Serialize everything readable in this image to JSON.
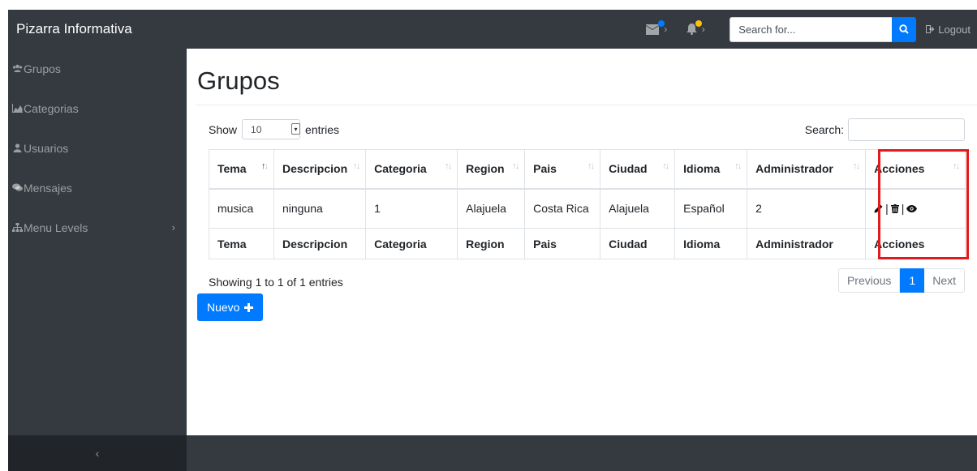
{
  "header": {
    "brand": "Pizarra Informativa",
    "search_placeholder": "Search for...",
    "logout_label": "Logout",
    "messages_dot_color": "#007bff",
    "alerts_dot_color": "#ffc107"
  },
  "sidebar": {
    "items": [
      {
        "label": "Grupos",
        "icon": "users-icon"
      },
      {
        "label": "Categorias",
        "icon": "area-chart-icon"
      },
      {
        "label": "Usuarios",
        "icon": "user-icon"
      },
      {
        "label": "Mensajes",
        "icon": "comments-icon"
      },
      {
        "label": "Menu Levels",
        "icon": "sitemap-icon"
      }
    ],
    "toggle_glyph": "‹"
  },
  "main": {
    "title": "Grupos",
    "length": {
      "show_label": "Show",
      "value": "10",
      "entries_label": "entries"
    },
    "filter_label": "Search:",
    "table": {
      "columns": [
        "Tema",
        "Descripcion",
        "Categoria",
        "Region",
        "Pais",
        "Ciudad",
        "Idioma",
        "Administrador",
        "Acciones"
      ],
      "rows": [
        [
          "musica",
          "ninguna",
          "1",
          "Alajuela",
          "Costa Rica",
          "Alajuela",
          "Español",
          "2"
        ]
      ],
      "actions_separator": "|"
    },
    "info": "Showing 1 to 1 of 1 entries",
    "pagination": {
      "previous": "Previous",
      "page": "1",
      "next": "Next"
    },
    "new_button": "Nuevo",
    "highlight_color": "#e3191c"
  }
}
